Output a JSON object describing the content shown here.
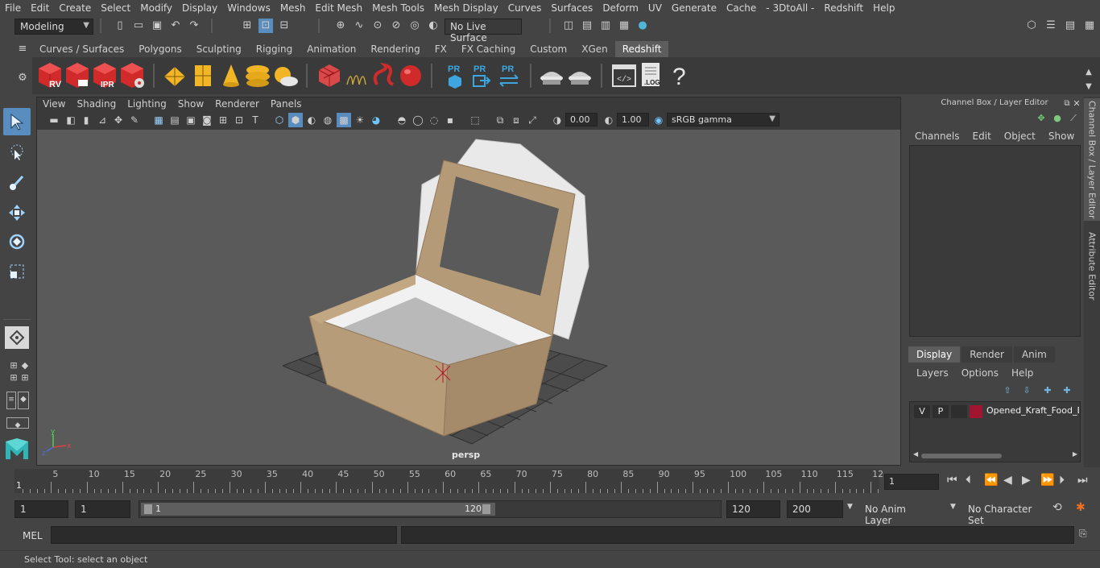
{
  "menubar": {
    "items": [
      "File",
      "Edit",
      "Create",
      "Select",
      "Modify",
      "Display",
      "Windows",
      "Mesh",
      "Edit Mesh",
      "Mesh Tools",
      "Mesh Display",
      "Curves",
      "Surfaces",
      "Deform",
      "UV",
      "Generate",
      "Cache",
      "- 3DtoAll -",
      "Redshift",
      "Help"
    ]
  },
  "statusline": {
    "workspace": "Modeling",
    "live_surface": "No Live Surface"
  },
  "shelf": {
    "tabs": [
      "Curves / Surfaces",
      "Polygons",
      "Sculpting",
      "Rigging",
      "Animation",
      "Rendering",
      "FX",
      "FX Caching",
      "Custom",
      "XGen",
      "Redshift"
    ],
    "active_tab": "Redshift",
    "icons": {
      "rv": "RV",
      "ipr": "IPR",
      "pr": "PR",
      "log": ".LOG",
      "help": "?"
    }
  },
  "viewport": {
    "menu": [
      "View",
      "Shading",
      "Lighting",
      "Show",
      "Renderer",
      "Panels"
    ],
    "exposure": "0.00",
    "gamma": "1.00",
    "colorspace": "sRGB gamma",
    "camera_label": "persp",
    "axis": {
      "x": "x",
      "y": "y",
      "z": "z"
    }
  },
  "channelbox": {
    "title": "Channel Box / Layer Editor",
    "menu": [
      "Channels",
      "Edit",
      "Object",
      "Show"
    ],
    "layer_tabs": [
      "Display",
      "Render",
      "Anim"
    ],
    "active_layer_tab": "Display",
    "layer_menu": [
      "Layers",
      "Options",
      "Help"
    ],
    "layer": {
      "v": "V",
      "p": "P",
      "name": "Opened_Kraft_Food_B",
      "color": "#a01530"
    }
  },
  "side_tabs": [
    "Channel Box / Layer Editor",
    "Attribute Editor"
  ],
  "timeline": {
    "ticks": [
      "5",
      "10",
      "15",
      "20",
      "25",
      "30",
      "35",
      "40",
      "45",
      "50",
      "55",
      "60",
      "65",
      "70",
      "75",
      "80",
      "85",
      "90",
      "95",
      "100",
      "105",
      "110",
      "115",
      "12"
    ],
    "start_marker": "1",
    "current_frame": "1"
  },
  "range": {
    "start": "1",
    "playback_start": "1",
    "slider_start": "1",
    "slider_end": "120",
    "playback_end": "120",
    "end": "200",
    "anim_layer": "No Anim Layer",
    "character_set": "No Character Set"
  },
  "commandline": {
    "label": "MEL"
  },
  "helpline": {
    "text": "Select Tool: select an object"
  }
}
